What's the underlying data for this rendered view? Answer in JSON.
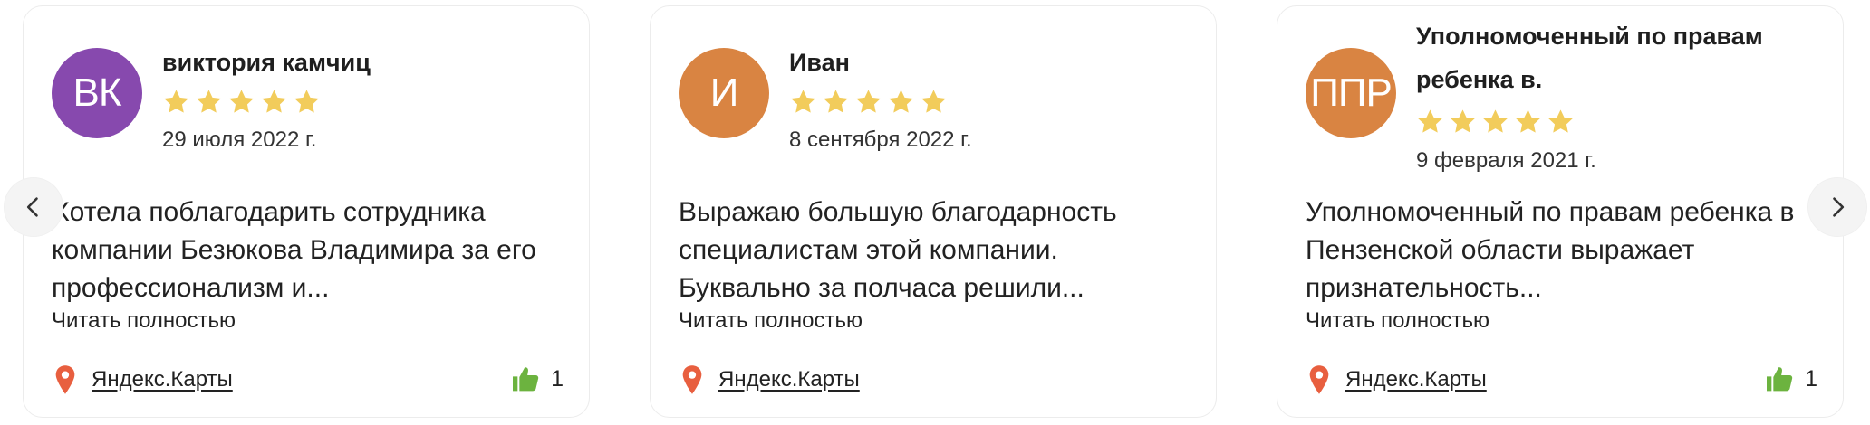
{
  "colors": {
    "star": "#f2cc5b",
    "pin": "#e85f3f",
    "thumb": "#6cb33f",
    "avatar_purple": "#8749ae",
    "avatar_orange": "#d98442"
  },
  "navigation": {
    "prev_icon": "chevron-left-icon",
    "next_icon": "chevron-right-icon"
  },
  "reviews": [
    {
      "initials": "ВК",
      "avatar_color": "#8749ae",
      "author": "виктория камчиц",
      "rating": 5,
      "date": "29 июля 2022 г.",
      "text": "Хотела поблагодарить сотрудника компании Безюкова Владимира за его профессионализм и...",
      "read_more": "Читать полностью",
      "source": "Яндекс.Карты",
      "likes": "1"
    },
    {
      "initials": "И",
      "avatar_color": "#d98442",
      "author": "Иван",
      "rating": 5,
      "date": "8 сентября 2022 г.",
      "text": "Выражаю большую благодарность специалистам этой компании. Буквально за полчаса решили...",
      "read_more": "Читать полностью",
      "source": "Яндекс.Карты",
      "likes": ""
    },
    {
      "initials": "ППР",
      "avatar_color": "#d98442",
      "author": "Уполномоченный по правам ребенка в.",
      "rating": 5,
      "date": "9 февраля 2021 г.",
      "text": "Уполномоченный по правам ребенка в Пензенской области выражает признательность...",
      "read_more": "Читать полностью",
      "source": "Яндекс.Карты",
      "likes": "1"
    }
  ]
}
